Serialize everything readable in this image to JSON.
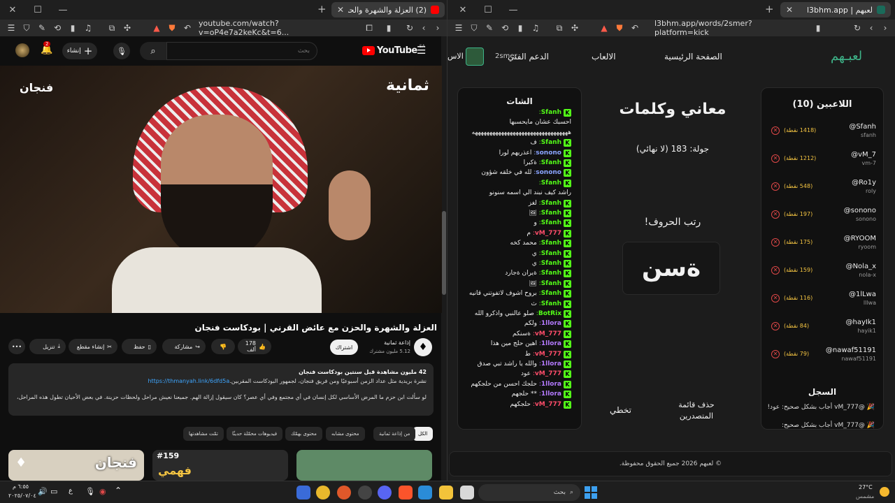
{
  "left_window": {
    "tab_title": "(2) العزلة والشهرة والحزن مع عا",
    "url": "youtube.com/watch?v=oP4e7a2keKc&t=6...",
    "search_placeholder": "بحث",
    "create_label": "إنشاء",
    "notif_count": "2",
    "youtube_word": "YouTube",
    "youtube_region": "SA",
    "video_overlay_brand": "ثمانية",
    "video_overlay_show": "فنجان",
    "video_title": "العزلة والشهرة والحزن مع عائض القرني | بودكاست فنجان",
    "channel_name": "إذاعة ثمانية",
    "channel_subs": "5.12 مليون مشترك",
    "subscribe_label": "اشتراك",
    "like_count": "178 ألف",
    "share_label": "مشاركة",
    "save_label": "حفظ",
    "clip_label": "إنشاء مقطع",
    "download_label": "تنزيل",
    "desc_stats": "42 مليون مشاهدة  قبل سنتين  بودكاست فنجان",
    "desc_line1": "نشرة بريدية مثل عداد الزمن أسبوعيًا ومن فريق فنجان، لجمهور البودكاست المقربين.",
    "desc_link": "https://thmanyah.link/6dfd5a",
    "desc_line2": "لو سألت ابن حزم ما المرض الأساسي لكل إنسان في أي مجتمع وفي أي عصر؟ كان سيقول إزالة الهم. جميعنا نعيش مراحل ولحظات حزينة. في بعض الأحيان تطول هذه المراحل، وبعض الناس يكون ...المزيد",
    "categories": [
      "الكل",
      "من إذاعة ثمانية",
      "محتوى مشابه",
      "محتوى بهمّك",
      "فيديوهات محمّلة حديثًا",
      "تمّت مشاهدتها"
    ],
    "thumb_badge": "#159",
    "thumb1_text": "فهمي",
    "thumb2_text": "فنجان"
  },
  "right_window": {
    "tab_title": "لعبهم | l3bhm.app",
    "url": "l3bhm.app/words/2smer?platform=kick",
    "logo": "لعبـهم",
    "nav_items": [
      "الصفحة الرئيسية",
      "الالعاب",
      "الدعم الفني"
    ],
    "nav_user": "2smer",
    "nav_cut": "الاس",
    "players_title": "اللاعبين (10)",
    "players": [
      {
        "name": "@Sfanh",
        "user": "sfanh",
        "score": "(1418 نقطة)"
      },
      {
        "name": "@vM_7",
        "user": "vm-7",
        "score": "(1212 نقطة)"
      },
      {
        "name": "@Ro1y",
        "user": "roly",
        "score": "(548 نقطة)"
      },
      {
        "name": "@sonono",
        "user": "sonono",
        "score": "(197 نقطة)"
      },
      {
        "name": "@RYOOM",
        "user": "ryoom",
        "score": "(175 نقطة)"
      },
      {
        "name": "@Nola_x",
        "user": "nola-x",
        "score": "(159 نقطة)"
      },
      {
        "name": "@1lLwa",
        "user": "lllwa",
        "score": "(116 نقطة)"
      },
      {
        "name": "@hayIk1",
        "user": "hayik1",
        "score": "(84 نقطة)"
      },
      {
        "name": "@nawaf51191",
        "user": "nawaf51191",
        "score": "(79 نقطة)"
      }
    ],
    "log_title": "السجل",
    "log_entries": [
      "🎉 @vM_777 أجاب بشكل صحيح: عود!",
      "🎉 @vM_777 أجاب بشكل صحيح:"
    ],
    "game_title": "معاني وكلمات",
    "round_text": "جولة: 183 (لا نهائي)",
    "sort_prompt": "رتب الحروف!",
    "scrambled": "ةسن",
    "skip_label": "تخطي",
    "clear_board_label": "حذف قائمة المتصدرين",
    "chat_title": "الشات",
    "chat": [
      {
        "user": "Sfanh",
        "color": "#53fc18",
        "msg": ""
      },
      {
        "user": "",
        "color": "#eee",
        "msg": "احسبك عشان مايحسبها"
      },
      {
        "user": "",
        "color": "#eee",
        "msg": "هههههههههههههههههههههههههههههههههه"
      },
      {
        "user": "Sfanh",
        "color": "#53fc18",
        "msg": "ف"
      },
      {
        "user": "sonono",
        "color": "#8aa4ff",
        "msg": "اعذريهم لورا"
      },
      {
        "user": "Sfanh",
        "color": "#53fc18",
        "msg": "ةكبرا"
      },
      {
        "user": "sonono",
        "color": "#8aa4ff",
        "msg": "لله في خلقه شؤون"
      },
      {
        "user": "Sfanh",
        "color": "#53fc18",
        "msg": ""
      },
      {
        "user": "",
        "color": "#eee",
        "msg": "راشد كيف نبند الي اسمه سنونو"
      },
      {
        "user": "Sfanh",
        "color": "#53fc18",
        "msg": "لغز"
      },
      {
        "user": "Sfanh",
        "color": "#53fc18",
        "msg": "🖼"
      },
      {
        "user": "Sfanh",
        "color": "#53fc18",
        "msg": "و"
      },
      {
        "user": "vM_777",
        "color": "#ff4d6a",
        "msg": "م"
      },
      {
        "user": "Sfanh",
        "color": "#53fc18",
        "msg": "محمد كخه"
      },
      {
        "user": "Sfanh",
        "color": "#53fc18",
        "msg": "ي"
      },
      {
        "user": "Sfanh",
        "color": "#53fc18",
        "msg": "ي"
      },
      {
        "user": "Sfanh",
        "color": "#53fc18",
        "msg": "ةيران ةجارد"
      },
      {
        "user": "Sfanh",
        "color": "#53fc18",
        "msg": "🖼"
      },
      {
        "user": "Sfanh",
        "color": "#53fc18",
        "msg": "بروح اشوف لاتفوتني قانيه"
      },
      {
        "user": "Sfanh",
        "color": "#53fc18",
        "msg": "ث"
      },
      {
        "user": "BotRix",
        "color": "#53fc18",
        "msg": "صلو عالنبي واذكرو الله"
      },
      {
        "user": "1llora",
        "color": "#b37aff",
        "msg": "ولكم"
      },
      {
        "user": "vM_777",
        "color": "#ff4d6a",
        "msg": "ةسنكم"
      },
      {
        "user": "1llora",
        "color": "#b37aff",
        "msg": "اهين حلج مين هذا"
      },
      {
        "user": "vM_777",
        "color": "#ff4d6a",
        "msg": "ط"
      },
      {
        "user": "1llora",
        "color": "#b37aff",
        "msg": "والله يا راشد تبي صدق"
      },
      {
        "user": "vM_777",
        "color": "#ff4d6a",
        "msg": "عود"
      },
      {
        "user": "1llora",
        "color": "#b37aff",
        "msg": "حلجك احسن من حلجكهم"
      },
      {
        "user": "1llora",
        "color": "#b37aff",
        "msg": "** حلجهم"
      },
      {
        "user": "vM_777",
        "color": "#ff4d6a",
        "msg": "حلجكهم"
      }
    ],
    "footer": "© لعبهم 2026 جميع الحقوق محفوظة."
  },
  "taskbar": {
    "search_placeholder": "بحث",
    "weather_temp": "27°C",
    "weather_desc": "مشمس",
    "time": "٦:٥٥ م",
    "date": "٢٠٢٥/٠٧/٠٤",
    "lang": "ع"
  }
}
